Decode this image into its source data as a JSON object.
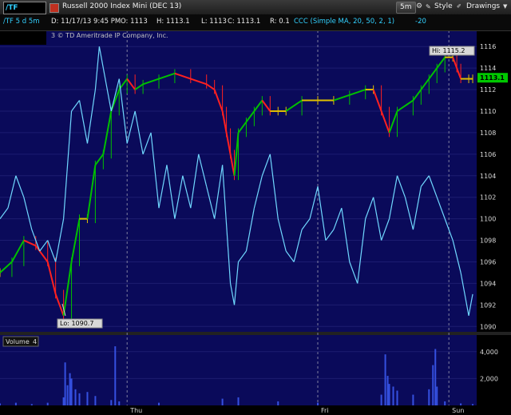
{
  "toolbar": {
    "title": "Russell 2000 Index Mini (DEC 13)",
    "timeframe": "5m",
    "style_label": "Style",
    "drawings_label": "Drawings"
  },
  "info": {
    "symbol": "/TF",
    "period": "/TF 5 d 5m",
    "date": "D: 11/17/13 9:45 PM",
    "open": "O: 1113",
    "high": "H: 1113.1",
    "low": "L: 1113",
    "close": "C: 1113.1",
    "range": "R: 0.1",
    "study": "CCC (Simple MA, 20, 50, 2, 1)",
    "study_value": "-20"
  },
  "copyright": "3 © TD Ameritrade IP Company, Inc.",
  "volume_label": "Volume",
  "volume_value": "4",
  "colors": {
    "panel_bg": "#0a0a5a",
    "grid": "#1c1c70",
    "price_up": "#00c000",
    "price_down": "#ff2020",
    "price_neutral": "#e0c000",
    "indicator": "#70d8ff",
    "volume": "#3550e0",
    "last_price_bg": "#00c800"
  },
  "chart_data": {
    "type": "line",
    "title": "Russell 2000 Index Mini (DEC 13)",
    "x_ticks": [
      "Thu",
      "Fri",
      "Sun"
    ],
    "day_separators": [
      "Thu",
      "Fri",
      "Sun"
    ],
    "y_ticks": [
      1090,
      1092,
      1094,
      1096,
      1098,
      1100,
      1102,
      1104,
      1106,
      1108,
      1110,
      1112,
      1114,
      1116
    ],
    "ylim": [
      1089.5,
      1117.5
    ],
    "last_price": "1113.1",
    "annotations": {
      "high": "Hi: 1115.2",
      "low": "Lo: 1090.7"
    },
    "grid": true,
    "series": [
      {
        "style": "candles",
        "x": [
          0,
          15,
          30,
          45,
          60,
          70,
          80,
          90,
          100,
          110,
          120,
          130,
          140,
          150,
          160,
          170,
          180,
          200,
          220,
          240,
          260,
          270,
          280,
          285,
          290,
          295,
          300,
          310,
          320,
          330,
          340,
          350,
          360,
          380,
          400,
          420,
          440,
          460,
          470,
          480,
          490,
          500,
          520,
          530,
          540,
          550,
          560,
          570,
          575,
          580,
          590,
          595
        ],
        "values": [
          1095,
          1096,
          1098,
          1097.5,
          1096,
          1093,
          1091,
          1096,
          1100,
          1100,
          1105,
          1106,
          1110,
          1112,
          1113,
          1112,
          1112.5,
          1113,
          1113.5,
          1113,
          1112.5,
          1112,
          1110,
          1108,
          1106,
          1104,
          1108,
          1109,
          1110,
          1111,
          1110,
          1110,
          1110,
          1111,
          1111,
          1111,
          1111.5,
          1112,
          1112,
          1110,
          1108,
          1110,
          1111,
          1112,
          1113,
          1114,
          1115,
          1115,
          1114,
          1113,
          1113,
          1113
        ]
      },
      {
        "style": "line",
        "name": "CCC (Simple MA, 20, 50, 2, 1)",
        "x": [
          0,
          10,
          20,
          30,
          40,
          50,
          60,
          70,
          80,
          90,
          100,
          110,
          120,
          125,
          130,
          140,
          150,
          160,
          170,
          180,
          190,
          200,
          210,
          220,
          230,
          240,
          250,
          260,
          270,
          280,
          290,
          295,
          300,
          310,
          320,
          330,
          340,
          350,
          360,
          370,
          380,
          390,
          400,
          410,
          420,
          430,
          440,
          450,
          460,
          470,
          480,
          490,
          500,
          510,
          520,
          530,
          540,
          550,
          560,
          570,
          580,
          590,
          595
        ],
        "values": [
          1100,
          1101,
          1104,
          1102,
          1099,
          1097,
          1098,
          1096,
          1100,
          1110,
          1111,
          1107,
          1112,
          1116,
          1114,
          1110,
          1113,
          1107,
          1110,
          1106,
          1108,
          1101,
          1105,
          1100,
          1104,
          1101,
          1106,
          1103,
          1100,
          1105,
          1094,
          1092,
          1096,
          1097,
          1101,
          1104,
          1106,
          1100,
          1097,
          1096,
          1099,
          1100,
          1103,
          1098,
          1099,
          1101,
          1096,
          1094,
          1100,
          1102,
          1098,
          1100,
          1104,
          1102,
          1099,
          1103,
          1104,
          1102,
          1100,
          1098,
          1095,
          1091,
          1093
        ]
      },
      {
        "style": "volume_bars",
        "name": "Volume",
        "ylim": [
          0,
          5000
        ],
        "y_ticks": [
          2000,
          4000
        ],
        "x": [
          0,
          20,
          40,
          60,
          80,
          82,
          85,
          88,
          90,
          95,
          100,
          110,
          120,
          140,
          145,
          150,
          200,
          280,
          300,
          350,
          400,
          480,
          485,
          488,
          490,
          495,
          500,
          520,
          540,
          545,
          548,
          550,
          560,
          580,
          595
        ],
        "values": [
          150,
          200,
          100,
          200,
          600,
          3200,
          1500,
          2400,
          2000,
          1200,
          900,
          1000,
          700,
          400,
          4400,
          300,
          200,
          500,
          600,
          300,
          200,
          800,
          3800,
          2200,
          1600,
          1400,
          1100,
          800,
          1200,
          3000,
          4200,
          1400,
          300,
          150,
          100
        ]
      }
    ]
  }
}
